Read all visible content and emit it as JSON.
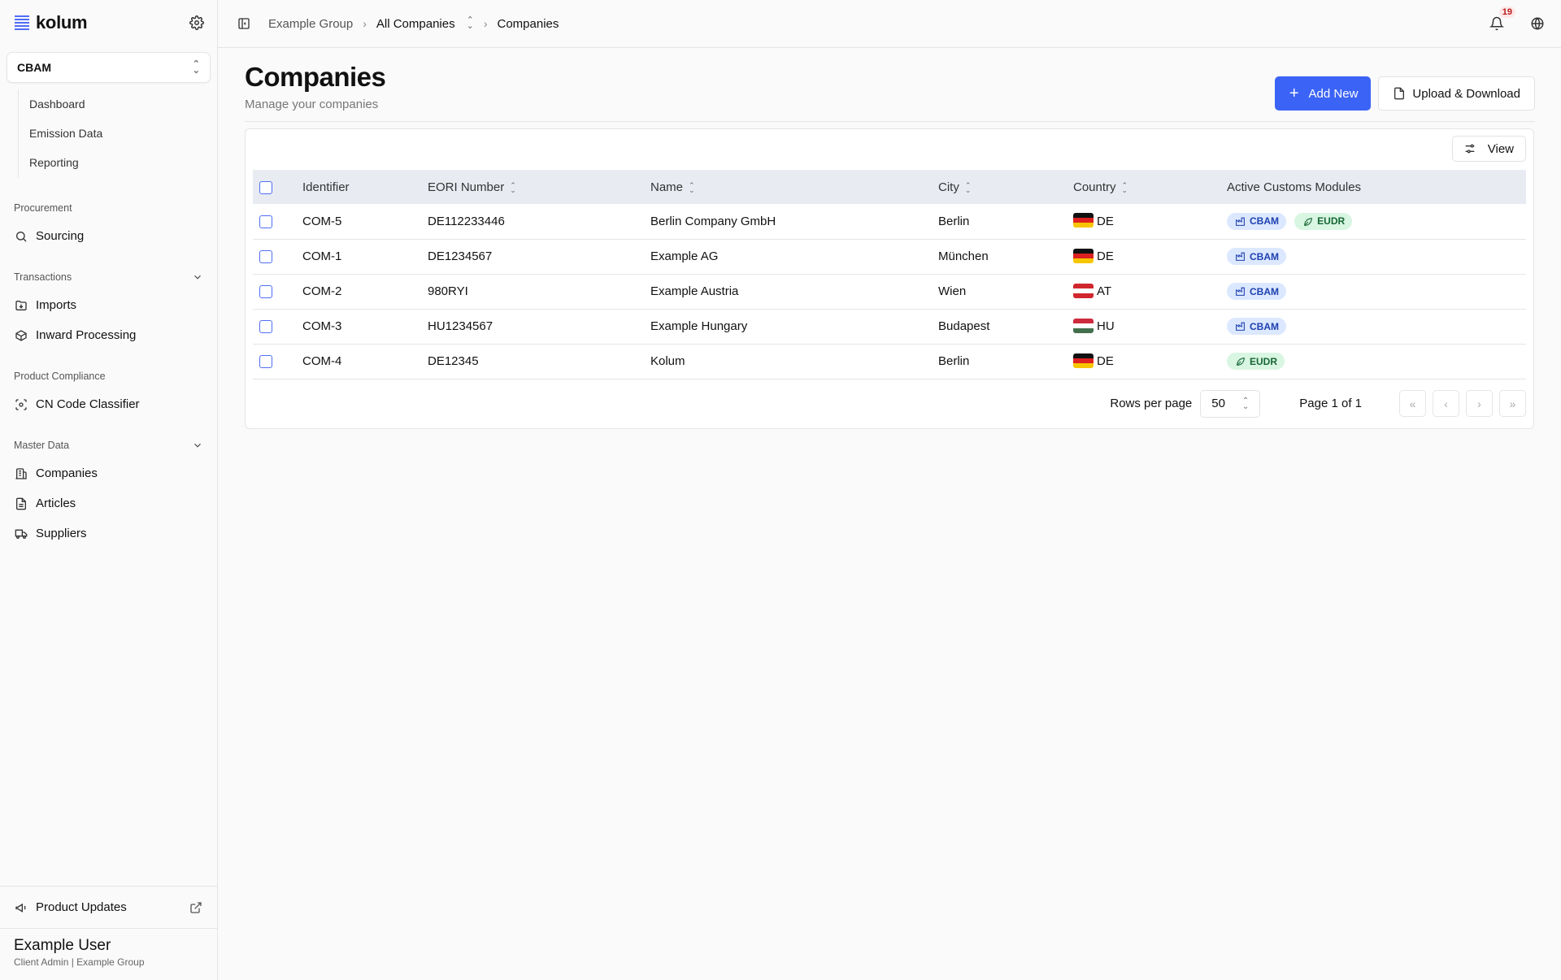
{
  "sidebar": {
    "brand": "kolum",
    "module": "CBAM",
    "module_items": [
      "Dashboard",
      "Emission Data",
      "Reporting"
    ],
    "groups": {
      "procurement": {
        "label": "Procurement",
        "items": [
          "Sourcing"
        ]
      },
      "transactions": {
        "label": "Transactions",
        "items": [
          "Imports",
          "Inward Processing"
        ]
      },
      "product_compliance": {
        "label": "Product Compliance",
        "items": [
          "CN Code Classifier"
        ]
      },
      "master_data": {
        "label": "Master Data",
        "items": [
          "Companies",
          "Articles",
          "Suppliers"
        ]
      }
    },
    "product_updates": "Product Updates",
    "user": {
      "name": "Example User",
      "role": "Client Admin | Example Group"
    }
  },
  "topbar": {
    "breadcrumb": [
      "Example Group",
      "All Companies",
      "Companies"
    ],
    "notification_count": "19"
  },
  "page": {
    "title": "Companies",
    "subtitle": "Manage your companies",
    "add_new": "Add New",
    "upload_download": "Upload & Download",
    "view": "View"
  },
  "table": {
    "columns": [
      "Identifier",
      "EORI Number",
      "Name",
      "City",
      "Country",
      "Active Customs Modules"
    ],
    "rows": [
      {
        "identifier": "COM-5",
        "eori": "DE112233446",
        "name": "Berlin Company GmbH",
        "city": "Berlin",
        "country": "DE",
        "modules": [
          "CBAM",
          "EUDR"
        ]
      },
      {
        "identifier": "COM-1",
        "eori": "DE1234567",
        "name": "Example AG",
        "city": "München",
        "country": "DE",
        "modules": [
          "CBAM"
        ]
      },
      {
        "identifier": "COM-2",
        "eori": "980RYI",
        "name": "Example Austria",
        "city": "Wien",
        "country": "AT",
        "modules": [
          "CBAM"
        ]
      },
      {
        "identifier": "COM-3",
        "eori": "HU1234567",
        "name": "Example Hungary",
        "city": "Budapest",
        "country": "HU",
        "modules": [
          "CBAM"
        ]
      },
      {
        "identifier": "COM-4",
        "eori": "DE12345",
        "name": "Kolum",
        "city": "Berlin",
        "country": "DE",
        "modules": [
          "EUDR"
        ]
      }
    ]
  },
  "pagination": {
    "rows_per_page_label": "Rows per page",
    "rows_per_page": "50",
    "page_info": "Page 1 of 1"
  },
  "colors": {
    "accent": "#3b63f6",
    "cbam_tag_bg": "#dbe8ff",
    "eudr_tag_bg": "#d8f6e2",
    "badge_bg": "#fde7e7"
  }
}
